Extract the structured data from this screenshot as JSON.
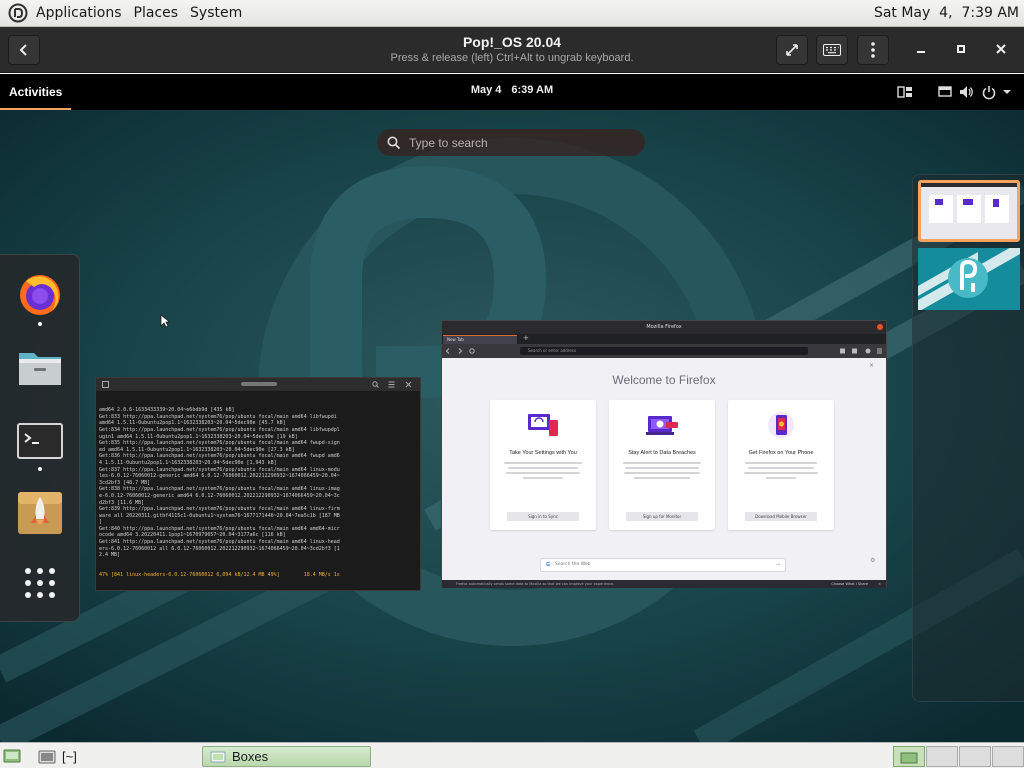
{
  "host_panel": {
    "menus": [
      "Applications",
      "Places",
      "System"
    ],
    "clock": "Sat May  4,  7:39 AM"
  },
  "boxes_header": {
    "title": "Pop!_OS 20.04",
    "subtitle": "Press & release (left) Ctrl+Alt to ungrab keyboard.",
    "icons": [
      "back-icon",
      "fullscreen-icon",
      "keyboard-icon",
      "kebab-menu-icon",
      "minimize-icon",
      "maximize-icon",
      "close-icon"
    ]
  },
  "guest": {
    "activities": "Activities",
    "date": "May 4",
    "time": "6:39 AM",
    "search_placeholder": "Type to search",
    "dash": [
      "firefox-icon",
      "files-icon",
      "terminal-icon",
      "pop-shop-icon",
      "show-apps-icon"
    ],
    "terminal": {
      "lines": [
        "amd64 2.0.6-1633433339~20.04~e6bdb9d [435 kB]",
        "Get:833 http://ppa.launchpad.net/system76/pop/ubuntu focal/main amd64 libfwupdi",
        "amd64 1.5.11-0ubuntu2pop1.1~1632338203~20.04~5dec90e [45.7 kB]",
        "Get:834 http://ppa.launchpad.net/system76/pop/ubuntu focal/main amd64 libfwupdpl",
        "ugin1 amd64 1.5.11-0ubuntu2pop1.1~1632338203~20.04~5dec90e [19 kB]",
        "Get:835 http://ppa.launchpad.net/system76/pop/ubuntu focal/main amd64 fwupd-sign",
        "ed amd64 1.5.11-0ubuntu2pop1.1~1632338203~20.04~5dec90e [27.3 kB]",
        "Get:836 http://ppa.launchpad.net/system76/pop/ubuntu focal/main amd64 fwupd amd6",
        "4 1.5.11-0ubuntu2pop1.1~1632338203~20.04~5dec90e [1,943 kB]",
        "Get:837 http://ppa.launchpad.net/system76/pop/ubuntu focal/main amd64 linux-modu",
        "les-6.0.12-76060012-generic amd64 6.0.12-76060012.202212290932~1674066459~20.04~",
        "3cd2bf3 [48.7 MB]",
        "Get:838 http://ppa.launchpad.net/system76/pop/ubuntu focal/main amd64 linux-imag",
        "e-6.0.12-76060012-generic amd64 6.0.12-76060012.202212290932~1674066459~20.04~3c",
        "d2bf3 [11.6 MB]",
        "Get:839 http://ppa.launchpad.net/system76/pop/ubuntu focal/main amd64 linux-firm",
        "ware all 20220311.gitbf4115c1-0ubuntu1~system76~1677171446~20.04~7ea5c1b [187 MB",
        "]",
        "Get:840 http://ppa.launchpad.net/system76/pop/ubuntu focal/main amd64 amd64-micr",
        "ocode amd64 3.20220411.1pop1~1670979057~20.04~3177a6c [116 kB]",
        "Get:841 http://ppa.launchpad.net/system76/pop/ubuntu focal/main amd64 linux-head",
        "ers-6.0.12-76060012 all 6.0.12-76060012.202212290932~1674066459~20.04~3cd2bf3 [1",
        "2.4 MB]"
      ],
      "progress_line": "47% [841 linux-headers-6.0.12-76060012 6,094 kB/12.4 MB 49%]        18.4 MB/s 1s"
    },
    "firefox": {
      "title": "Mozilla Firefox",
      "tab": "New Tab",
      "url_placeholder": "Search or enter address",
      "welcome": "Welcome to Firefox",
      "cards": [
        {
          "icon": "devices-icon",
          "title": "Take Your Settings with You",
          "button": "Sign in to Sync"
        },
        {
          "icon": "breach-alert-icon",
          "title": "Stay Alert to Data Breaches",
          "button": "Sign up for Monitor"
        },
        {
          "icon": "phone-icon",
          "title": "Get Firefox on Your Phone",
          "button": "Download Mobile Browser"
        }
      ],
      "search_placeholder": "Search the Web",
      "notice": "Firefox automatically sends some data to Mozilla so that we can improve your experience.",
      "notice_button": "Choose What I Share"
    }
  },
  "taskbar": {
    "terminal_label": "[~]",
    "boxes_label": "Boxes"
  },
  "colors": {
    "accent": "#f6a35e",
    "guest_bg": "#123c43",
    "taskbar_active": "#c8e0bc"
  }
}
